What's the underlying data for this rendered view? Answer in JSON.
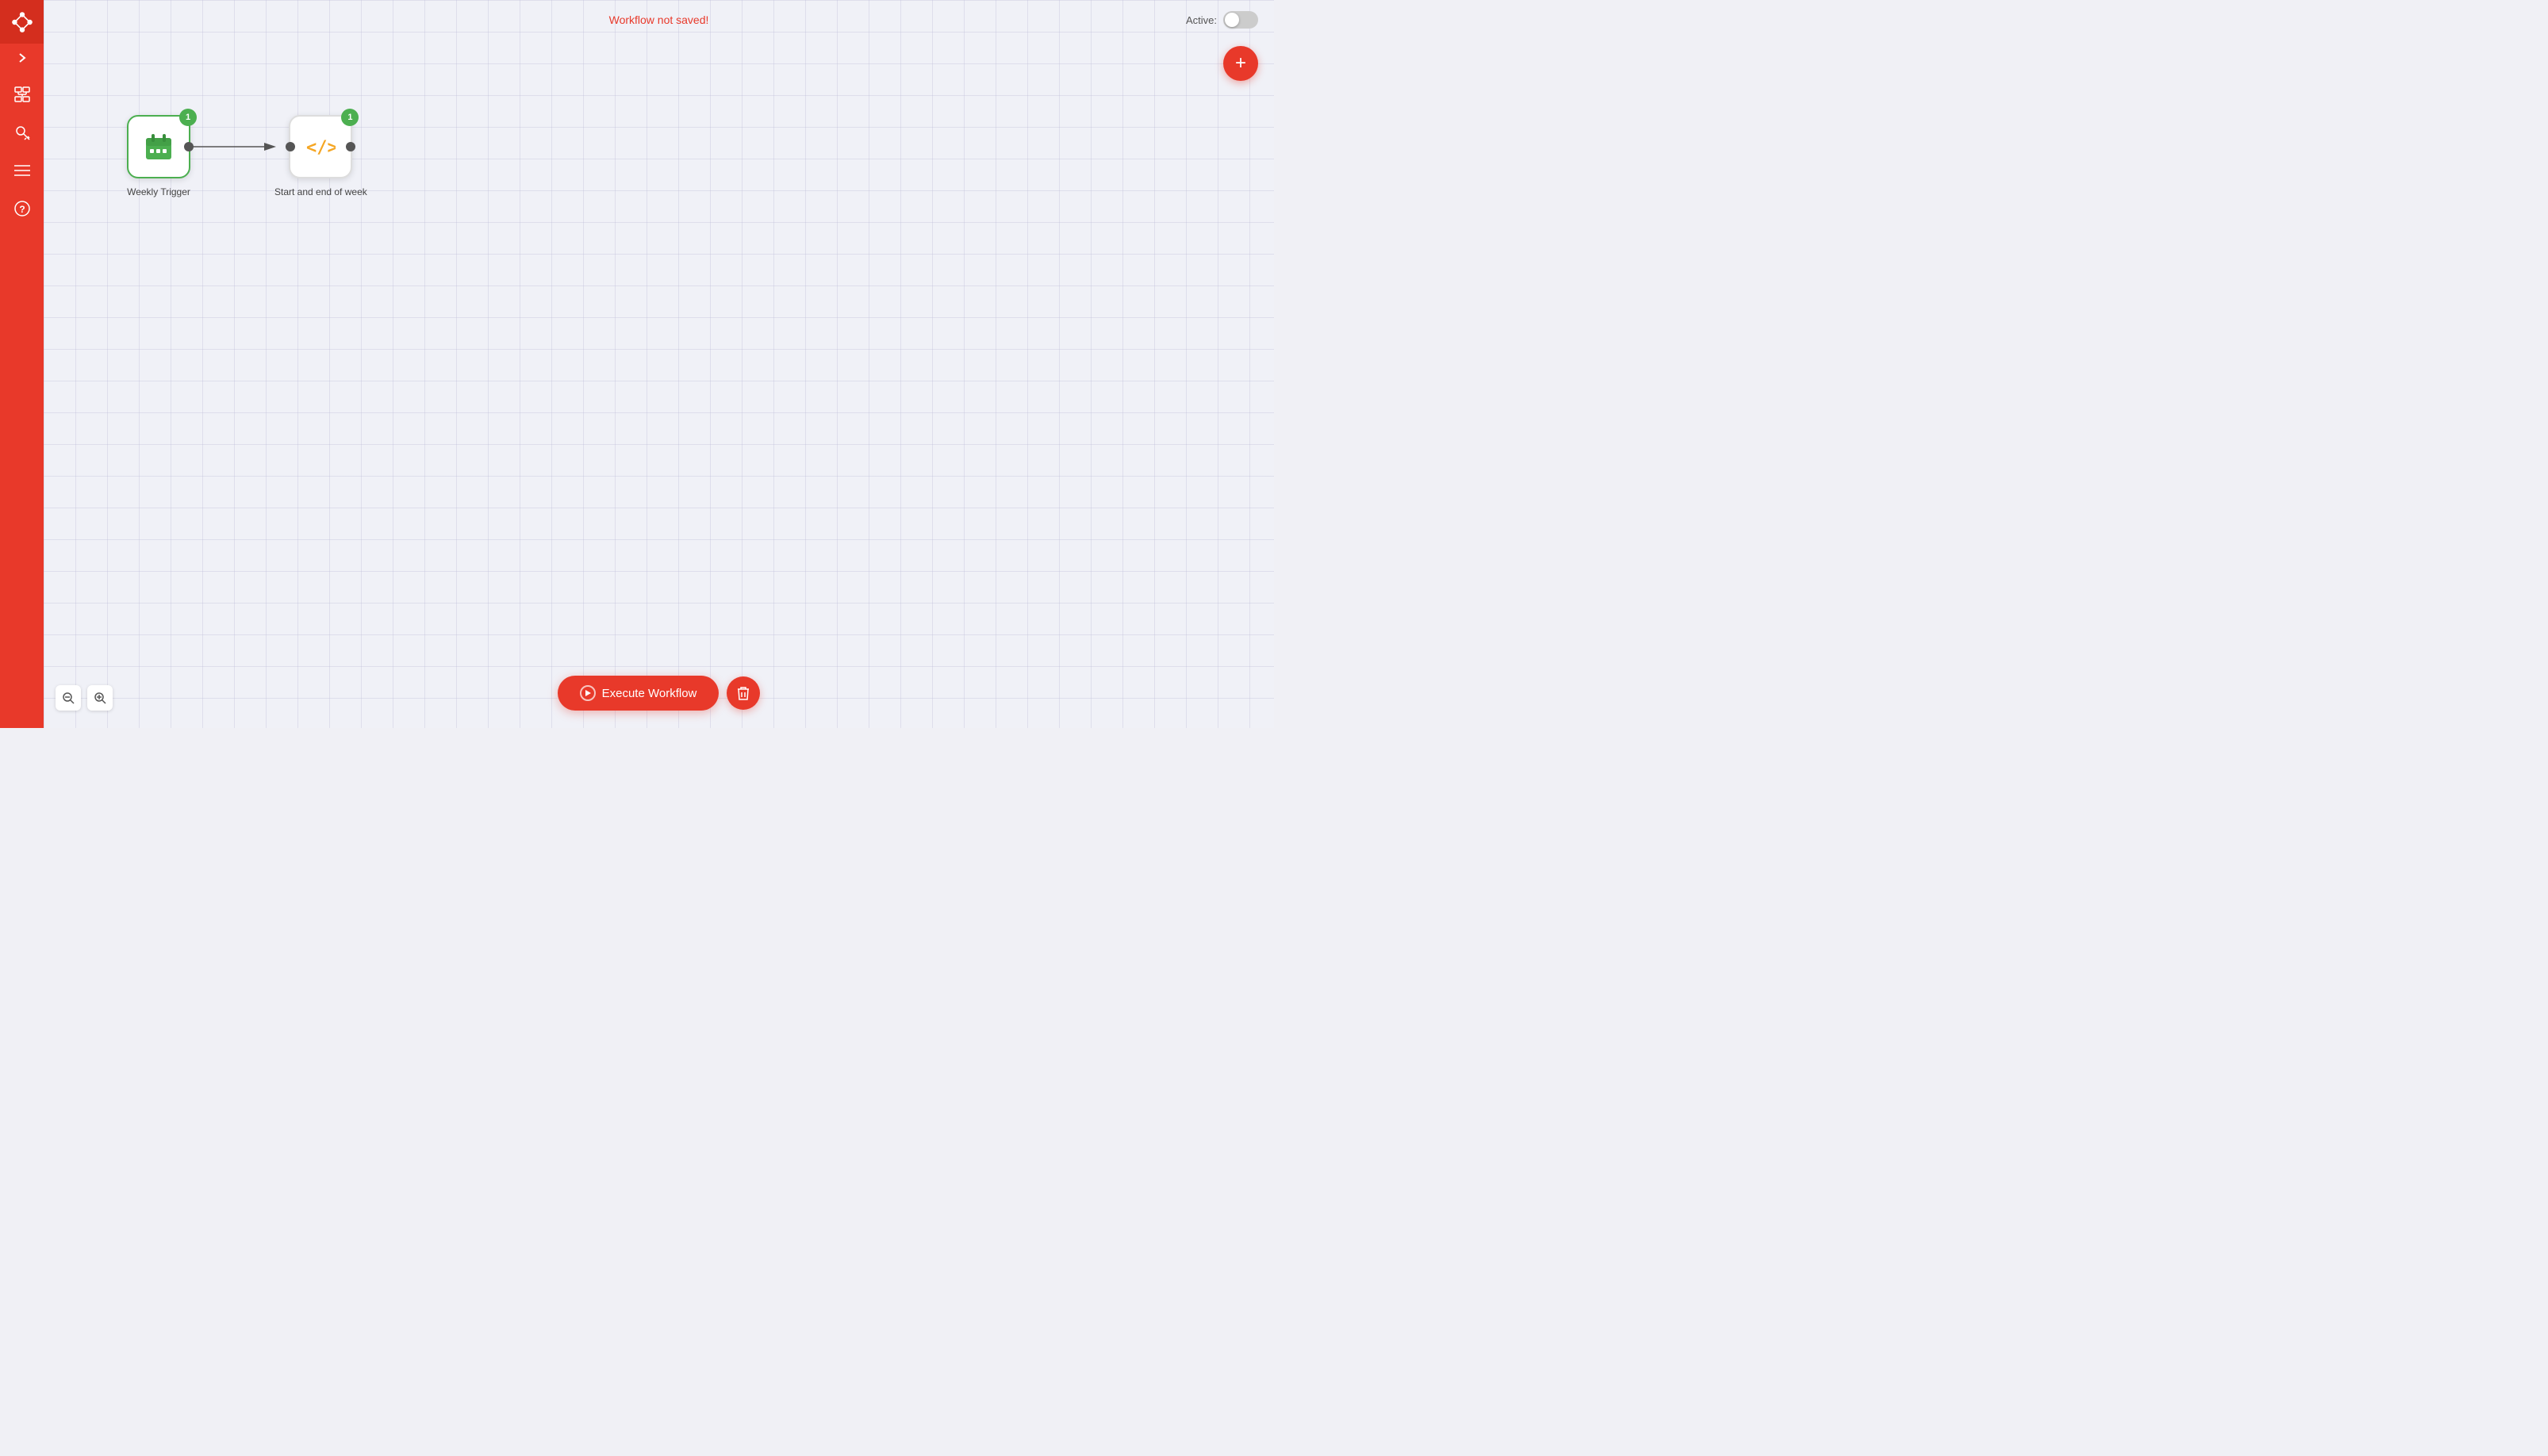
{
  "sidebar": {
    "logo_alt": "n8n logo",
    "items": [
      {
        "name": "workflows",
        "icon": "⊞",
        "label": "Workflows"
      },
      {
        "name": "credentials",
        "icon": "🔑",
        "label": "Credentials"
      },
      {
        "name": "executions",
        "icon": "≡",
        "label": "Executions"
      },
      {
        "name": "help",
        "icon": "?",
        "label": "Help"
      }
    ]
  },
  "topbar": {
    "status_text": "Workflow not saved!",
    "active_label": "Active:",
    "toggle_active": false
  },
  "canvas": {
    "add_button_label": "+"
  },
  "nodes": [
    {
      "id": "weekly-trigger",
      "label": "Weekly Trigger",
      "type": "trigger",
      "badge": "1",
      "icon": "calendar"
    },
    {
      "id": "code-node",
      "label": "Start and end of week",
      "type": "code",
      "badge": "1",
      "icon": "code"
    }
  ],
  "toolbar": {
    "execute_label": "Execute Workflow",
    "zoom_in_label": "+",
    "zoom_out_label": "-"
  }
}
